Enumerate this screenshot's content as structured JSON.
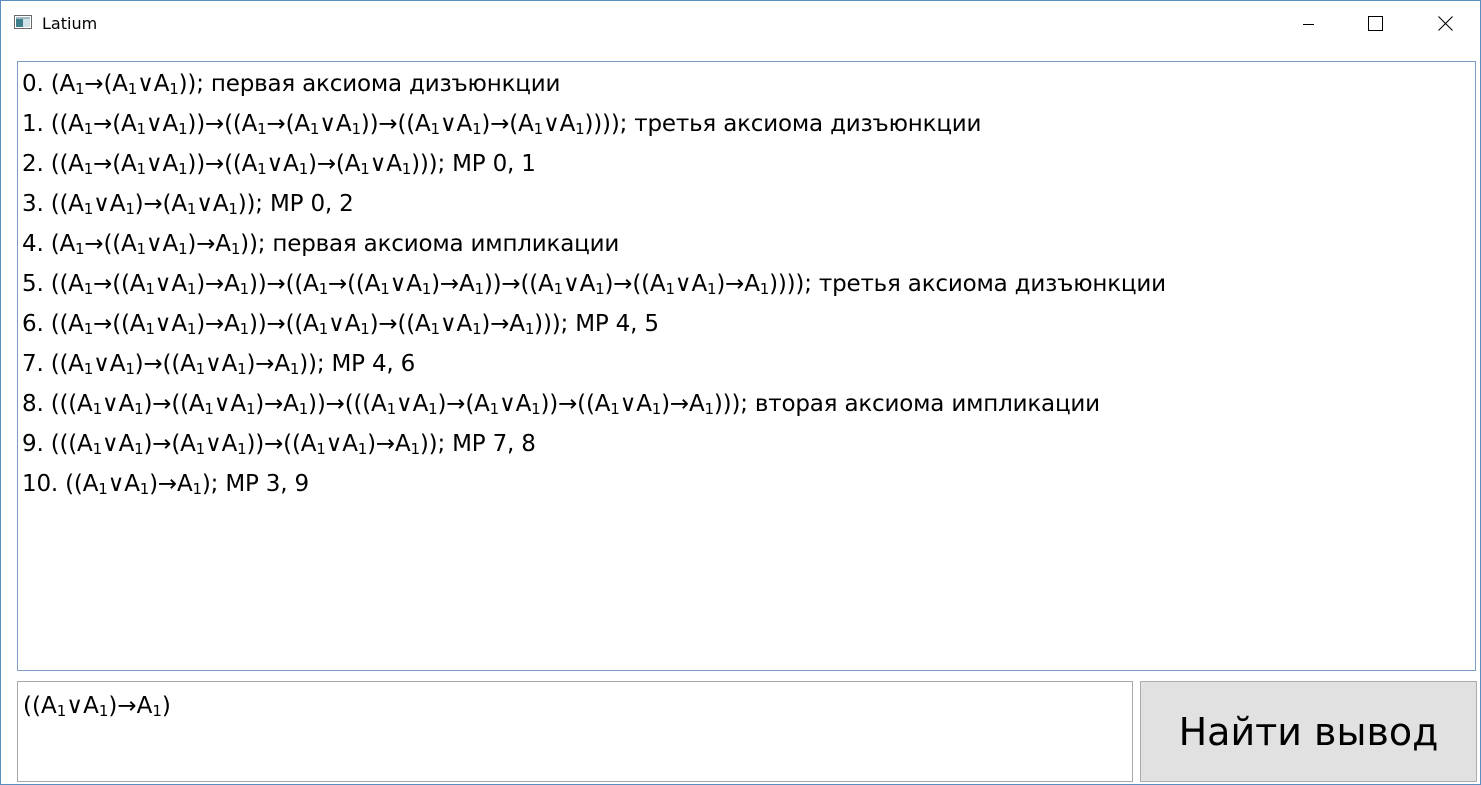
{
  "window": {
    "title": "Latium",
    "controls": {
      "minimize_icon": "minimize-icon",
      "maximize_icon": "maximize-icon",
      "close_icon": "close-icon"
    }
  },
  "proof": {
    "lines": [
      "0. (A₁→(A₁∨A₁)); первая аксиома дизъюнкции",
      "1. ((A₁→(A₁∨A₁))→((A₁→(A₁∨A₁))→((A₁∨A₁)→(A₁∨A₁)))); третья аксиома дизъюнкции",
      "2. ((A₁→(A₁∨A₁))→((A₁∨A₁)→(A₁∨A₁))); MP 0, 1",
      "3. ((A₁∨A₁)→(A₁∨A₁)); MP 0, 2",
      "4. (A₁→((A₁∨A₁)→A₁)); первая аксиома импликации",
      "5. ((A₁→((A₁∨A₁)→A₁))→((A₁→((A₁∨A₁)→A₁))→((A₁∨A₁)→((A₁∨A₁)→A₁)))); третья аксиома дизъюнкции",
      "6. ((A₁→((A₁∨A₁)→A₁))→((A₁∨A₁)→((A₁∨A₁)→A₁))); MP 4, 5",
      "7. ((A₁∨A₁)→((A₁∨A₁)→A₁)); MP 4, 6",
      "8. (((A₁∨A₁)→((A₁∨A₁)→A₁))→(((A₁∨A₁)→(A₁∨A₁))→((A₁∨A₁)→A₁))); вторая аксиома импликации",
      "9. (((A₁∨A₁)→(A₁∨A₁))→((A₁∨A₁)→A₁)); MP 7, 8",
      "10. ((A₁∨A₁)→A₁); MP 3, 9"
    ]
  },
  "input": {
    "value": "((A₁∨A₁)→A₁)"
  },
  "button": {
    "label": "Найти вывод"
  },
  "colors": {
    "window_border": "#5a8ec0",
    "button_background": "#e1e1e1",
    "button_border": "#adadad"
  }
}
